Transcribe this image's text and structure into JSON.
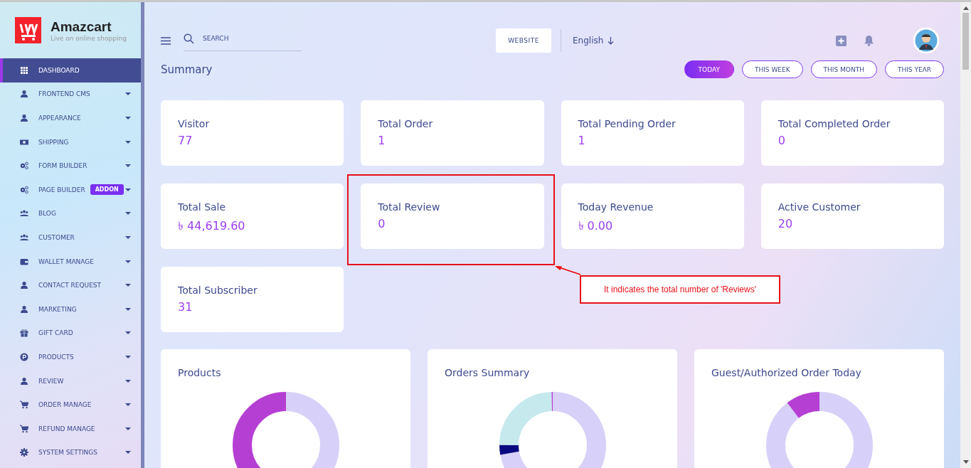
{
  "brand": {
    "name": "Amazcart",
    "tagline": "Live on online shopping"
  },
  "sidebar": {
    "items": [
      {
        "label": "DASHBOARD",
        "selected": true,
        "dropdown": false
      },
      {
        "label": "FRONTEND CMS",
        "selected": false,
        "dropdown": true
      },
      {
        "label": "APPEARANCE",
        "selected": false,
        "dropdown": true
      },
      {
        "label": "SHIPPING",
        "selected": false,
        "dropdown": true
      },
      {
        "label": "FORM BUILDER",
        "selected": false,
        "dropdown": true
      },
      {
        "label": "PAGE BUILDER",
        "selected": false,
        "dropdown": true,
        "badge": "ADDON"
      },
      {
        "label": "BLOG",
        "selected": false,
        "dropdown": true
      },
      {
        "label": "CUSTOMER",
        "selected": false,
        "dropdown": true
      },
      {
        "label": "WALLET MANAGE",
        "selected": false,
        "dropdown": true
      },
      {
        "label": "CONTACT REQUEST",
        "selected": false,
        "dropdown": true
      },
      {
        "label": "MARKETING",
        "selected": false,
        "dropdown": true
      },
      {
        "label": "GIFT CARD",
        "selected": false,
        "dropdown": true
      },
      {
        "label": "PRODUCTS",
        "selected": false,
        "dropdown": true
      },
      {
        "label": "REVIEW",
        "selected": false,
        "dropdown": true
      },
      {
        "label": "ORDER MANAGE",
        "selected": false,
        "dropdown": true
      },
      {
        "label": "REFUND MANAGE",
        "selected": false,
        "dropdown": true
      },
      {
        "label": "SYSTEM SETTINGS",
        "selected": false,
        "dropdown": true
      }
    ]
  },
  "header": {
    "search": {
      "placeholder": "SEARCH"
    },
    "website_button": "WEBSITE",
    "language": "English"
  },
  "summary": {
    "title": "Summary",
    "filters": [
      {
        "label": "TODAY",
        "selected": true
      },
      {
        "label": "THIS WEEK",
        "selected": false
      },
      {
        "label": "THIS MONTH",
        "selected": false
      },
      {
        "label": "THIS YEAR",
        "selected": false
      }
    ]
  },
  "stats": [
    {
      "label": "Visitor",
      "value": "77"
    },
    {
      "label": "Total Order",
      "value": "1"
    },
    {
      "label": "Total Pending Order",
      "value": "1"
    },
    {
      "label": "Total Completed Order",
      "value": "0"
    },
    {
      "label": "Total Sale",
      "value": "৳ 44,619.60"
    },
    {
      "label": "Total Review",
      "value": "0"
    },
    {
      "label": "Today Revenue",
      "value": "৳ 0.00"
    },
    {
      "label": "Active Customer",
      "value": "20"
    },
    {
      "label": "Total Subscriber",
      "value": "31"
    }
  ],
  "panels": [
    {
      "title": "Products"
    },
    {
      "title": "Orders Summary"
    },
    {
      "title": "Guest/Authorized Order Today"
    }
  ],
  "annotation": {
    "text": "It indicates the total number of 'Reviews'"
  }
}
